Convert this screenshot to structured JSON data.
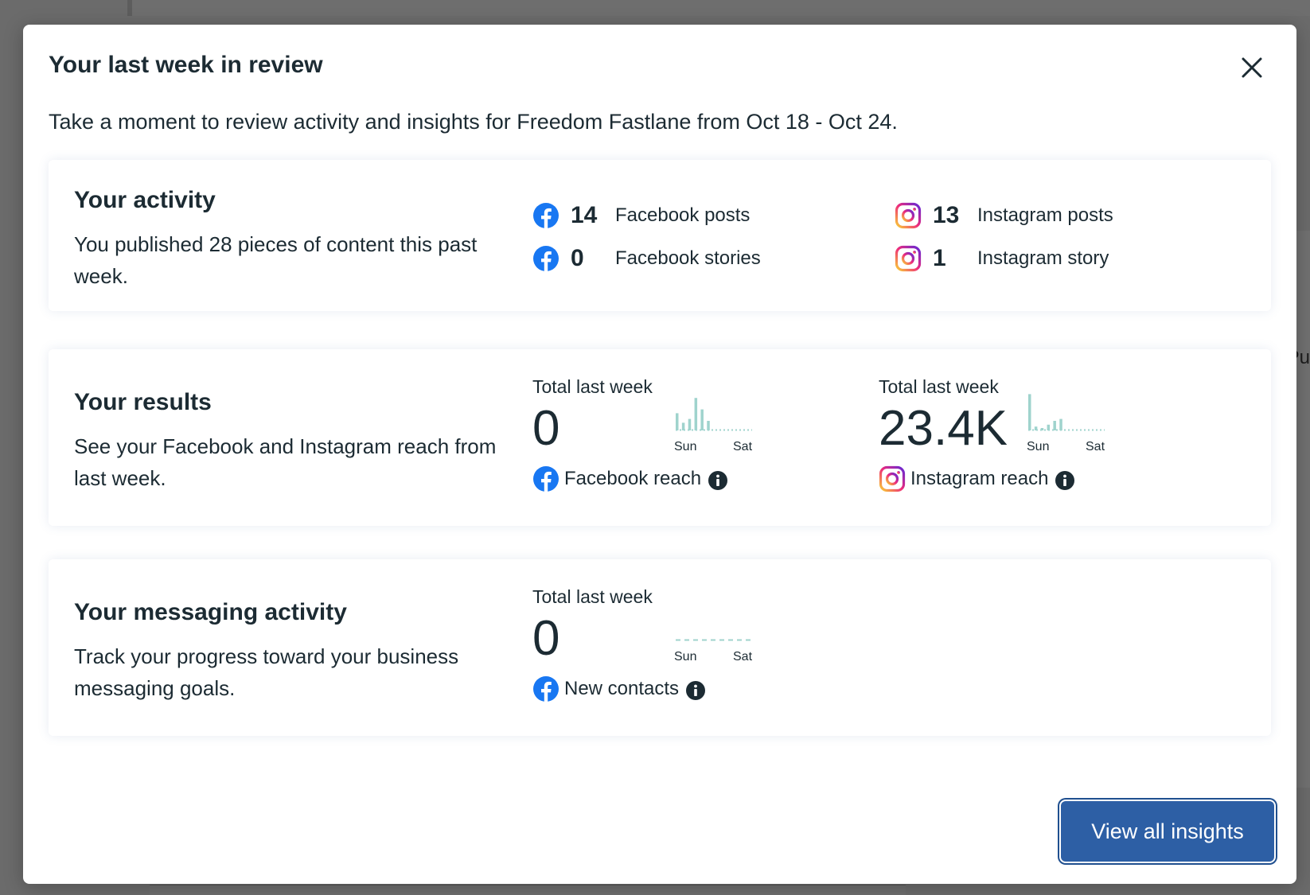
{
  "colors": {
    "facebook": "#1877f2",
    "instagram_gradient": [
      "#f9ce34",
      "#ee2a7b",
      "#6228d7"
    ],
    "spark": "#9fd3cd",
    "button": "#2d5fa5"
  },
  "background": {
    "partial_text": "Pu"
  },
  "modal": {
    "title": "Your last week in review",
    "subtitle": "Take a moment to review activity and insights for Freedom Fastlane from Oct 18 - Oct 24.",
    "close_icon": "close-icon"
  },
  "activity": {
    "heading": "Your activity",
    "description": "You published 28 pieces of content this past week.",
    "stats": [
      {
        "platform": "facebook",
        "icon": "facebook-icon",
        "value": "14",
        "label": "Facebook posts"
      },
      {
        "platform": "facebook",
        "icon": "facebook-icon",
        "value": "0",
        "label": "Facebook stories"
      },
      {
        "platform": "instagram",
        "icon": "instagram-icon",
        "value": "13",
        "label": "Instagram posts"
      },
      {
        "platform": "instagram",
        "icon": "instagram-icon",
        "value": "1",
        "label": "Instagram story"
      }
    ]
  },
  "results": {
    "heading": "Your results",
    "description": "See your Facebook and Instagram reach from last week.",
    "metrics": [
      {
        "label": "Total last week",
        "value": "0",
        "source": "Facebook reach",
        "icon": "facebook-icon",
        "axis_start": "Sun",
        "axis_end": "Sat",
        "spark": [
          0.45,
          0.2,
          0.3,
          0.85,
          0.55,
          0.25,
          0.0
        ]
      },
      {
        "label": "Total last week",
        "value": "23.4K",
        "source": "Instagram reach",
        "icon": "instagram-icon",
        "axis_start": "Sun",
        "axis_end": "Sat",
        "spark": [
          0.95,
          0.1,
          0.05,
          0.15,
          0.25,
          0.3,
          0.0
        ]
      }
    ]
  },
  "messaging": {
    "heading": "Your messaging activity",
    "description": "Track your progress toward your business messaging goals.",
    "metric": {
      "label": "Total last week",
      "value": "0",
      "source": "New contacts",
      "icon": "facebook-icon",
      "axis_start": "Sun",
      "axis_end": "Sat",
      "spark": [
        0,
        0,
        0,
        0,
        0,
        0,
        0
      ]
    }
  },
  "cta": {
    "label": "View all insights"
  }
}
